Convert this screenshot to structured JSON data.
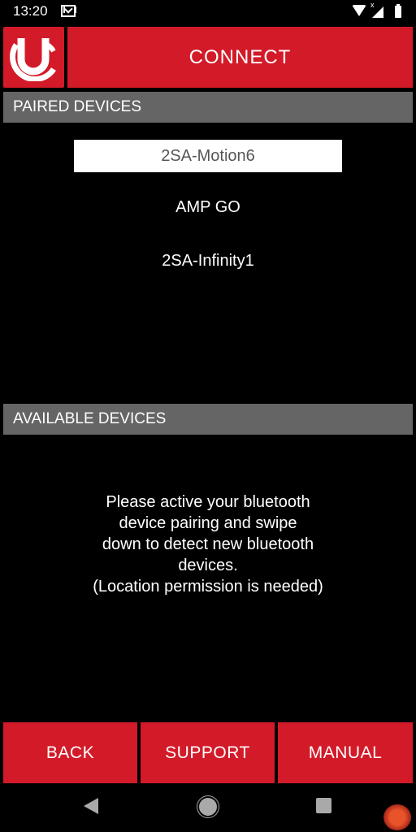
{
  "status_bar": {
    "time": "13:20",
    "icons": [
      "gmail-icon",
      "wifi-icon",
      "signal-icon",
      "battery-icon"
    ],
    "signal_badge": "x"
  },
  "header": {
    "logo": "uclear-logo",
    "title": "CONNECT",
    "accent_color": "#d31a28"
  },
  "paired": {
    "header": "PAIRED DEVICES",
    "devices": [
      {
        "name": "2SA-Motion6",
        "selected": true
      },
      {
        "name": "AMP GO",
        "selected": false
      },
      {
        "name": "2SA-Infinity1",
        "selected": false
      }
    ]
  },
  "available": {
    "header": "AVAILABLE DEVICES",
    "message": "Please active your bluetooth\ndevice pairing and swipe\ndown to detect new bluetooth\ndevices.\n(Location permission is needed)"
  },
  "footer": {
    "back_label": "BACK",
    "support_label": "SUPPORT",
    "manual_label": "MANUAL"
  },
  "nav": {
    "icons": [
      "nav-back-icon",
      "nav-home-icon",
      "nav-recents-icon"
    ]
  }
}
